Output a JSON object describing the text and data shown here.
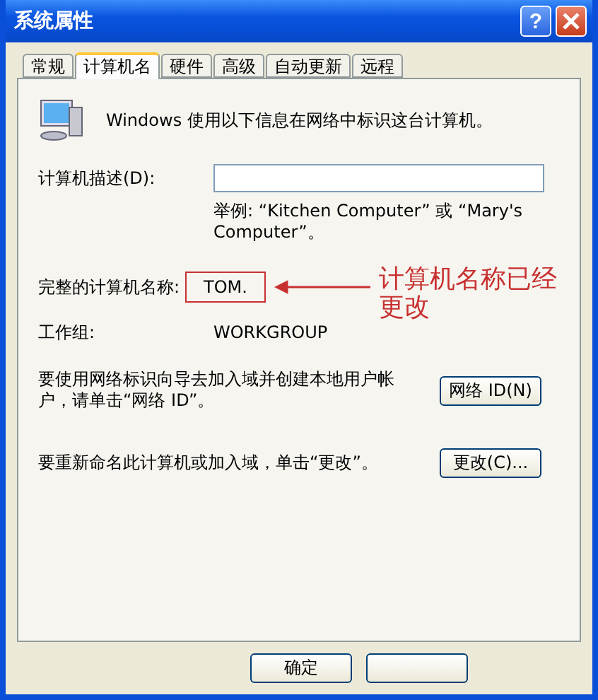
{
  "window": {
    "title": "系统属性",
    "help_button": "?"
  },
  "tabs": [
    {
      "label": "常规",
      "selected": false
    },
    {
      "label": "计算机名",
      "selected": true
    },
    {
      "label": "硬件",
      "selected": false
    },
    {
      "label": "高级",
      "selected": false
    },
    {
      "label": "自动更新",
      "selected": false
    },
    {
      "label": "远程",
      "selected": false
    }
  ],
  "intro": "Windows 使用以下信息在网络中标识这台计算机。",
  "description": {
    "label": "计算机描述(D):",
    "example": "举例: “Kitchen Computer” 或 “Mary's Computer”。"
  },
  "full_name": {
    "label": "完整的计算机名称:",
    "value": "TOM."
  },
  "workgroup": {
    "label": "工作组:",
    "value": "WORKGROUP"
  },
  "network_id": {
    "text": "要使用网络标识向导去加入域并创建本地用户帐户，请单击“网络 ID”。",
    "button": "网络 ID(N)"
  },
  "rename": {
    "text": "要重新命名此计算机或加入域，单击“更改”。",
    "button": "更改(C)..."
  },
  "annotation": {
    "text": "计算机名称已经更改"
  },
  "buttons": [
    {
      "label": "确定"
    }
  ]
}
